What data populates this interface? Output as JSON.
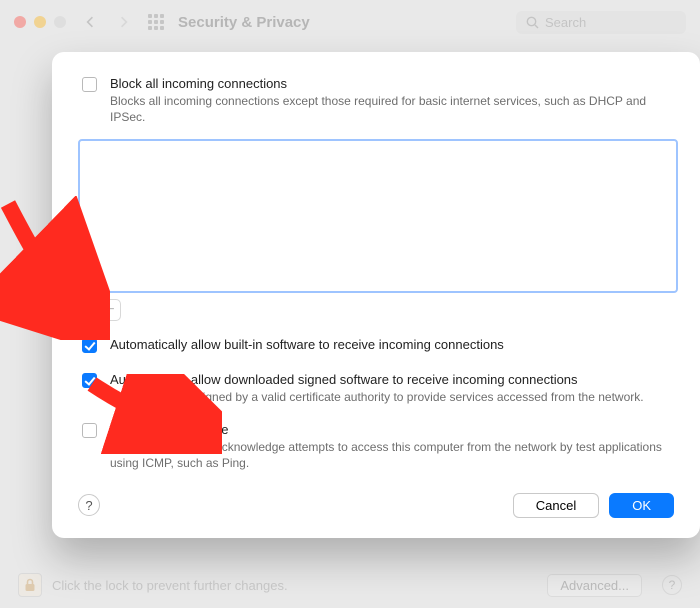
{
  "window": {
    "title": "Security & Privacy",
    "search_placeholder": "Search",
    "footer_text": "Click the lock to prevent further changes.",
    "advanced_label": "Advanced..."
  },
  "sheet": {
    "block_all": {
      "checked": false,
      "title": "Block all incoming connections",
      "desc": "Blocks all incoming connections except those required for basic internet services, such as DHCP and IPSec."
    },
    "auto_builtin": {
      "checked": true,
      "title": "Automatically allow built-in software to receive incoming connections"
    },
    "auto_signed": {
      "checked": true,
      "title": "Automatically allow downloaded signed software to receive incoming connections",
      "desc": "Allows software signed by a valid certificate authority to provide services accessed from the network."
    },
    "stealth": {
      "checked": false,
      "title": "Enable stealth mode",
      "desc": "Don't respond to or acknowledge attempts to access this computer from the network by test applications using ICMP, such as Ping."
    },
    "buttons": {
      "plus": "+",
      "minus": "−",
      "help": "?",
      "cancel": "Cancel",
      "ok": "OK"
    }
  }
}
